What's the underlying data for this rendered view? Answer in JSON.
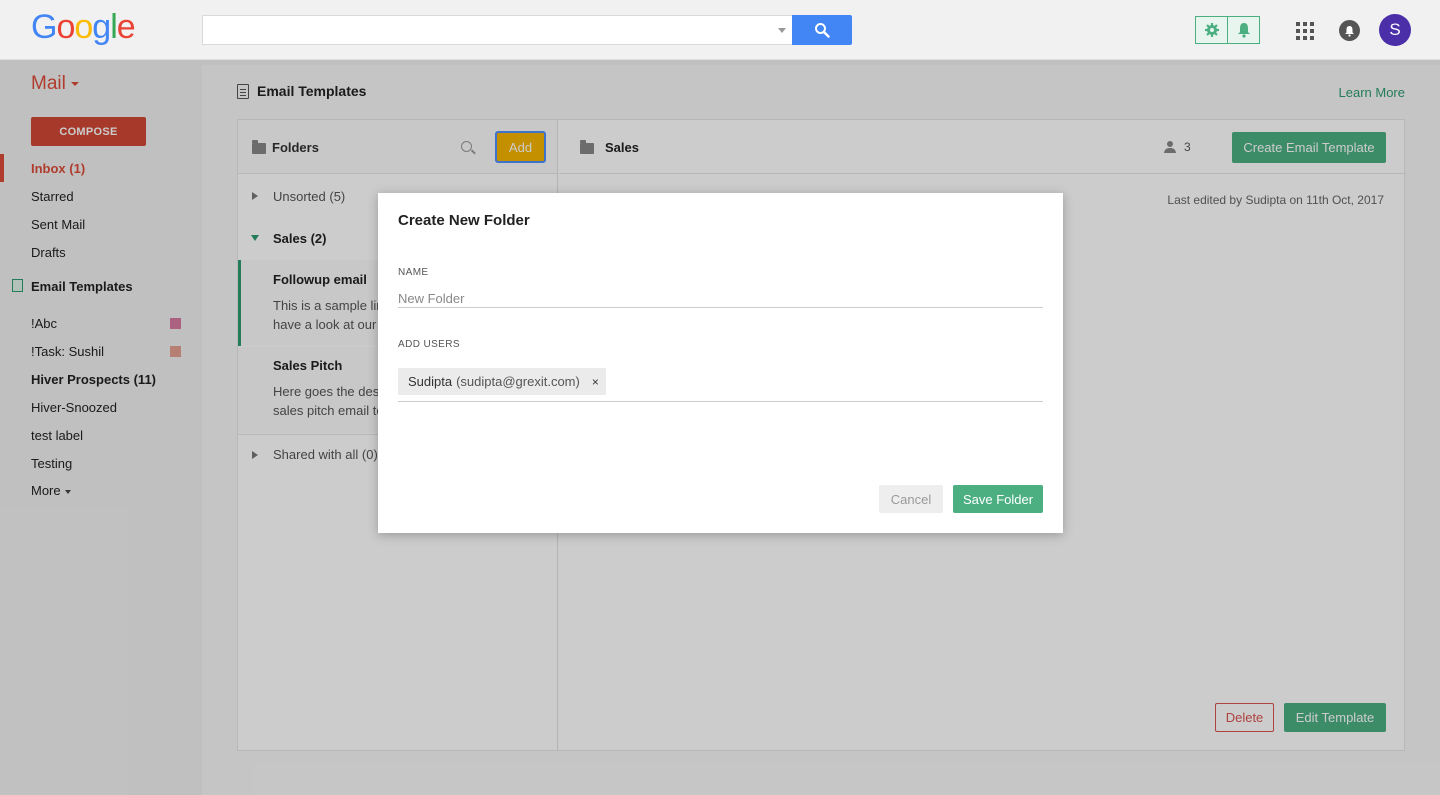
{
  "header": {
    "logo_letters": [
      "G",
      "o",
      "o",
      "g",
      "l",
      "e"
    ],
    "logo_colors": [
      "#4285f4",
      "#ea4335",
      "#fbbc05",
      "#4285f4",
      "#34a853",
      "#ea4335"
    ],
    "search": {
      "value": "",
      "placeholder": ""
    },
    "avatar_letter": "S",
    "icons": [
      "search-icon",
      "gear-icon",
      "bell-icon",
      "apps-grid-icon",
      "notifications-icon"
    ]
  },
  "sidebar": {
    "mail_label": "Mail",
    "compose_label": "COMPOSE",
    "nav": [
      {
        "label": "Inbox (1)"
      },
      {
        "label": "Starred"
      },
      {
        "label": "Sent Mail"
      },
      {
        "label": "Drafts"
      }
    ],
    "email_templates_label": "Email Templates",
    "labels": [
      {
        "label": "!Abc",
        "color": "#d97aa0"
      },
      {
        "label": "!Task: Sushil",
        "color": "#e5a091"
      },
      {
        "label": "Hiver Prospects (11)"
      },
      {
        "label": "Hiver-Snoozed"
      },
      {
        "label": "test label"
      },
      {
        "label": "Testing"
      }
    ],
    "more_label": "More"
  },
  "main": {
    "page_title": "Email Templates",
    "learn_more": "Learn More",
    "folders": {
      "title": "Folders",
      "add_label": "Add",
      "tree": [
        {
          "label": "Unsorted (5)"
        },
        {
          "label": "Sales (2)"
        },
        {
          "label": "Shared with all (0)"
        }
      ],
      "templates": [
        {
          "name": "Followup email",
          "desc_line1": "This is a sample lin",
          "desc_line2": "have a look at our"
        },
        {
          "name": "Sales Pitch",
          "desc_line1": "Here goes the des",
          "desc_line2": "sales pitch email te"
        }
      ]
    },
    "detail": {
      "folder_name": "Sales",
      "user_count": "3",
      "create_label": "Create Email Template",
      "last_edited": "Last edited by Sudipta on 11th Oct, 2017",
      "delete_label": "Delete",
      "edit_label": "Edit Template"
    }
  },
  "modal": {
    "title": "Create New Folder",
    "name_label": "NAME",
    "name_value": "",
    "name_placeholder": "New Folder",
    "add_users_label": "ADD USERS",
    "chip_name": "Sudipta",
    "chip_email": "(sudipta@grexit.com)",
    "chip_remove": "×",
    "cancel_label": "Cancel",
    "save_label": "Save Folder"
  },
  "colors": {
    "accent_green": "#4caf82",
    "gmail_red": "#dd4b39",
    "add_yellow": "#f5b400",
    "google_blue": "#4285f4",
    "avatar_purple": "#4a2fa8"
  }
}
